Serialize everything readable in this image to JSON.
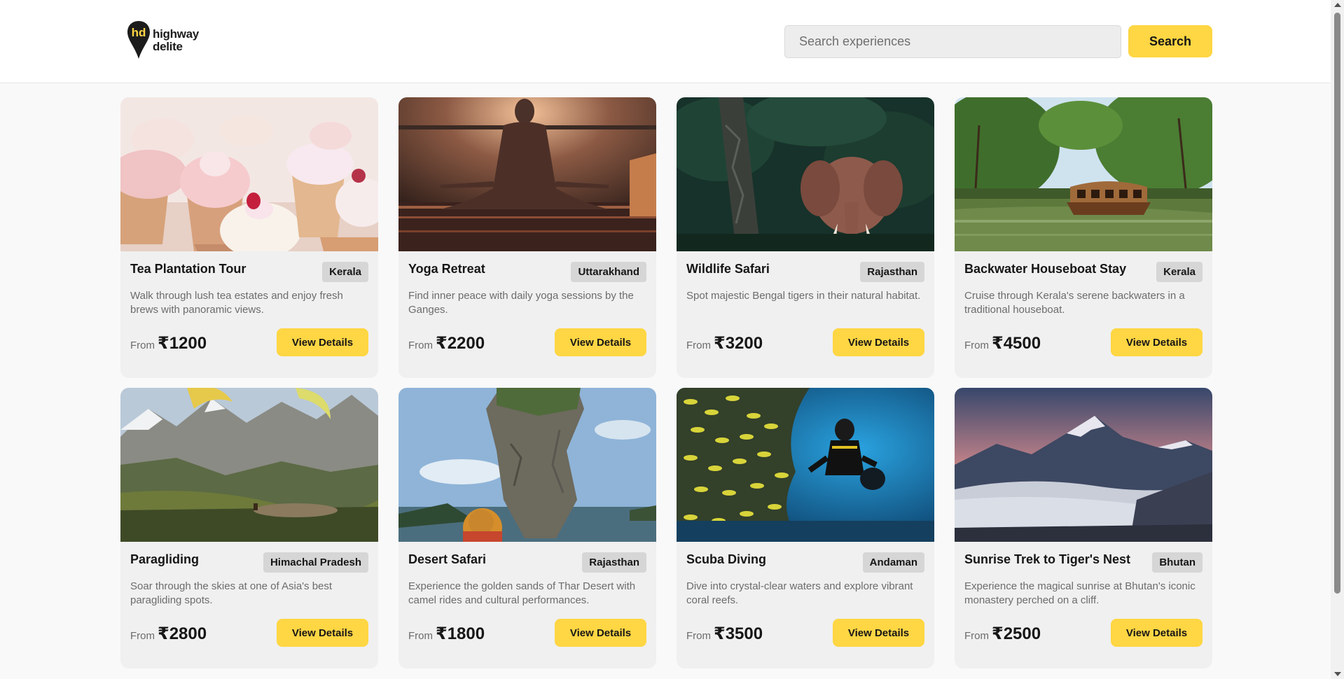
{
  "header": {
    "logo_line1": "highway",
    "logo_line2": "delite",
    "logo_mark": "hd",
    "search_placeholder": "Search experiences",
    "search_button": "Search"
  },
  "colors": {
    "accent": "#ffd643",
    "card_bg": "#f0f0f0",
    "badge_bg": "#d6d6d6",
    "page_bg": "#f9f9f9"
  },
  "cards": [
    {
      "title": "Tea Plantation Tour",
      "location": "Kerala",
      "description": "Walk through lush tea estates and enjoy fresh brews with panoramic views.",
      "from_label": "From",
      "price": "₹1200",
      "button": "View Details",
      "image": "cupcakes-photo"
    },
    {
      "title": "Yoga Retreat",
      "location": "Uttarakhand",
      "description": "Find inner peace with daily yoga sessions by the Ganges.",
      "from_label": "From",
      "price": "₹2200",
      "button": "View Details",
      "image": "yoga-sunset-photo"
    },
    {
      "title": "Wildlife Safari",
      "location": "Rajasthan",
      "description": "Spot majestic Bengal tigers in their natural habitat.",
      "from_label": "From",
      "price": "₹3200",
      "button": "View Details",
      "image": "elephant-forest-photo"
    },
    {
      "title": "Backwater Houseboat Stay",
      "location": "Kerala",
      "description": "Cruise through Kerala's serene backwaters in a traditional houseboat.",
      "from_label": "From",
      "price": "₹4500",
      "button": "View Details",
      "image": "houseboat-palms-photo"
    },
    {
      "title": "Paragliding",
      "location": "Himachal Pradesh",
      "description": "Soar through the skies at one of Asia's best paragliding spots.",
      "from_label": "From",
      "price": "₹2800",
      "button": "View Details",
      "image": "paraglider-mountains-photo"
    },
    {
      "title": "Desert Safari",
      "location": "Rajasthan",
      "description": "Experience the golden sands of Thar Desert with camel rides and cultural performances.",
      "from_label": "From",
      "price": "₹1800",
      "button": "View Details",
      "image": "rock-island-photo"
    },
    {
      "title": "Scuba Diving",
      "location": "Andaman",
      "description": "Dive into crystal-clear waters and explore vibrant coral reefs.",
      "from_label": "From",
      "price": "₹3500",
      "button": "View Details",
      "image": "diver-fish-photo"
    },
    {
      "title": "Sunrise Trek to Tiger's Nest",
      "location": "Bhutan",
      "description": "Experience the magical sunrise at Bhutan's iconic monastery perched on a cliff.",
      "from_label": "From",
      "price": "₹2500",
      "button": "View Details",
      "image": "mountain-clouds-photo"
    }
  ]
}
